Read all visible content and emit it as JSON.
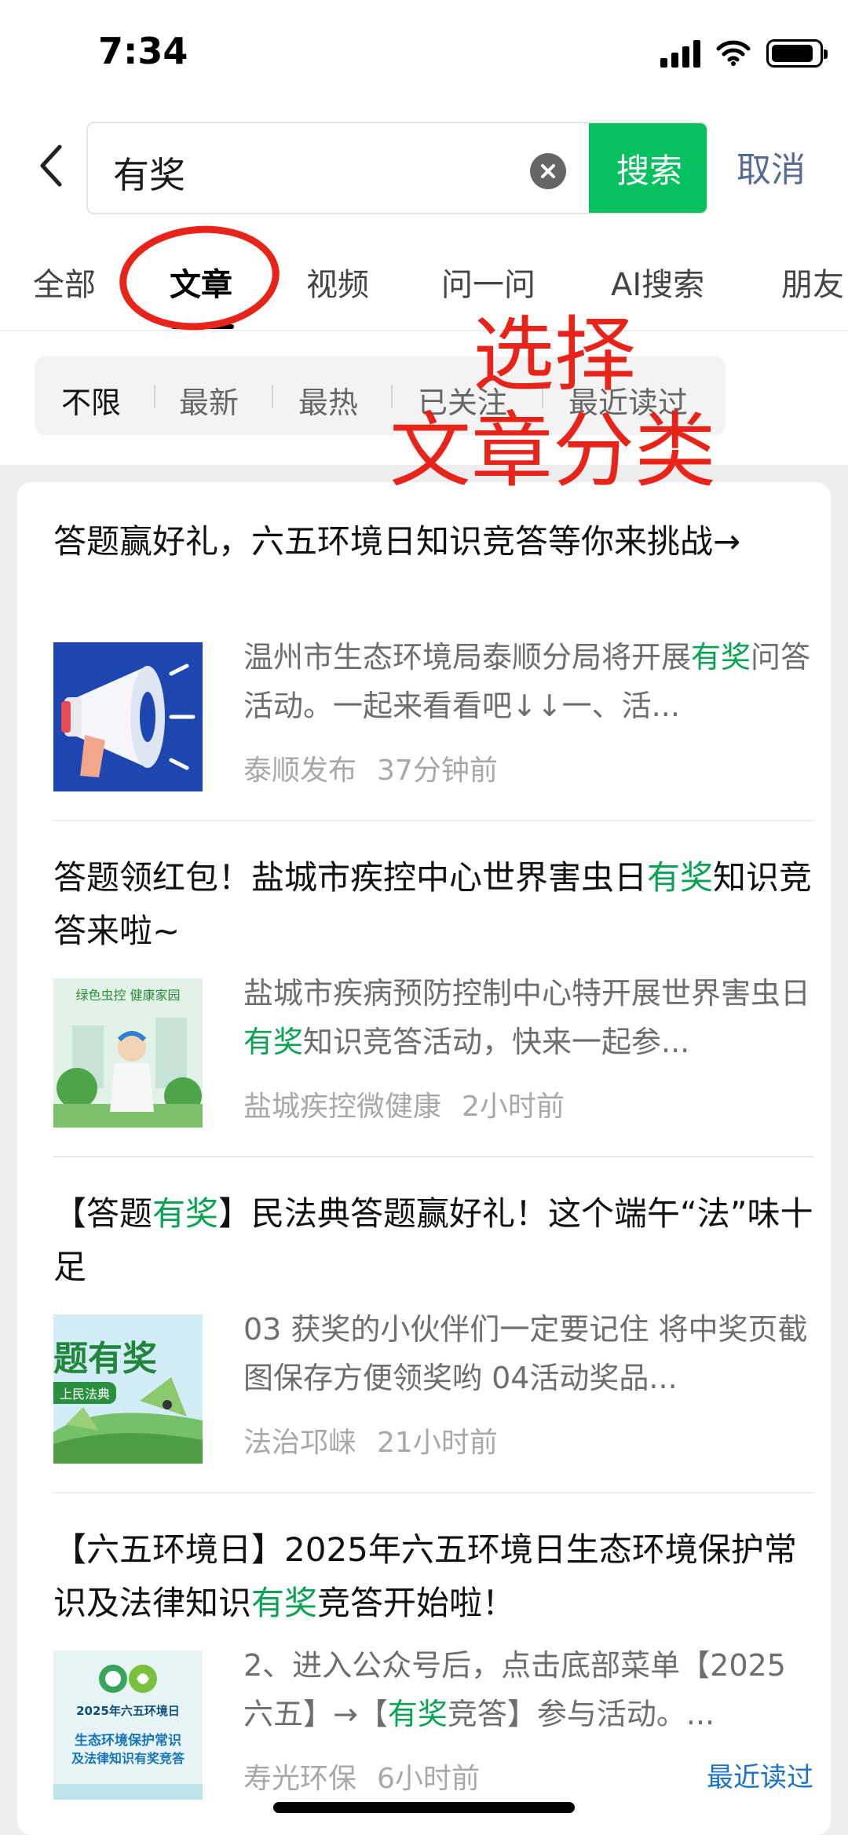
{
  "status_bar": {
    "time": "7:34",
    "signal_icon": "signal-icon",
    "wifi_icon": "wifi-icon",
    "battery_icon": "battery-icon"
  },
  "search": {
    "query": "有奖",
    "search_label": "搜索",
    "cancel_label": "取消"
  },
  "tabs": [
    {
      "label": "全部"
    },
    {
      "label": "文章",
      "active": true
    },
    {
      "label": "视频"
    },
    {
      "label": "问一问"
    },
    {
      "label": "AI搜索"
    },
    {
      "label": "朋友"
    }
  ],
  "filters": [
    {
      "label": "不限",
      "active": true
    },
    {
      "label": "最新"
    },
    {
      "label": "最热"
    },
    {
      "label": "已关注"
    },
    {
      "label": "最近读过"
    }
  ],
  "annotation": {
    "line1": "选择",
    "line2": "文章分类",
    "color": "#e8231a"
  },
  "colors": {
    "accent": "#07c160",
    "highlight": "#07a352",
    "link": "#576b95"
  },
  "articles": [
    {
      "title": [
        {
          "text": "答题赢好礼，六五环境日知识竞答等你来挑战→"
        }
      ],
      "snippet": [
        {
          "text": "温州市生态环境局泰顺分局将开展"
        },
        {
          "text": "有奖",
          "hl": true
        },
        {
          "text": "问答活动。一起来看看吧↓↓一、活..."
        }
      ],
      "source": "泰顺发布",
      "time": "37分钟前",
      "thumb_icon": "megaphone-icon"
    },
    {
      "title": [
        {
          "text": "答题领红包！盐城市疾控中心世界害虫日"
        },
        {
          "text": "有奖",
          "hl": true
        },
        {
          "text": "知识竞答来啦~"
        }
      ],
      "snippet": [
        {
          "text": "盐城市疾病预防控制中心特开展世界害虫日"
        },
        {
          "text": "有奖",
          "hl": true
        },
        {
          "text": "知识竞答活动，快来一起参..."
        }
      ],
      "source": "盐城疾控微健康",
      "time": "2小时前",
      "thumb_icon": "pest-control-illustration-icon",
      "thumb_text": [
        "绿色虫控 健康家园"
      ]
    },
    {
      "title": [
        {
          "text": "【答题"
        },
        {
          "text": "有奖",
          "hl": true
        },
        {
          "text": "】民法典答题赢好礼！这个端午“法”味十足"
        }
      ],
      "snippet": [
        {
          "text": "03 获奖的小伙伴们一定要记住 将中奖页截图保存方便领奖哟 04活动奖品..."
        }
      ],
      "source": "法治邛崃",
      "time": "21小时前",
      "thumb_icon": "dragon-boat-zongzi-icon",
      "thumb_text": [
        "题有奖",
        "上民法典"
      ]
    },
    {
      "title": [
        {
          "text": "【六五环境日】2025年六五环境日生态环境保护常识及法律知识"
        },
        {
          "text": "有奖",
          "hl": true
        },
        {
          "text": "竞答开始啦！"
        }
      ],
      "snippet": [
        {
          "text": "2、进入公众号后，点击底部菜单【2025六五】→【"
        },
        {
          "text": "有奖",
          "hl": true
        },
        {
          "text": "竞答】参与活动。..."
        }
      ],
      "source": "寿光环保",
      "time": "6小时前",
      "recent_tag": "最近读过",
      "thumb_icon": "environment-day-poster-icon",
      "thumb_text": [
        "2025年六五环境日",
        "生态环境保护常识",
        "及法律知识有奖竞答"
      ]
    }
  ]
}
